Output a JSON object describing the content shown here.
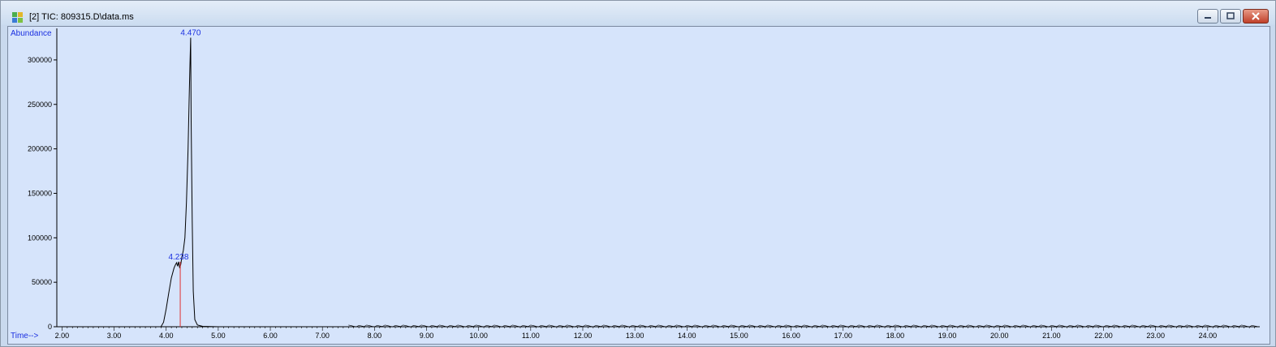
{
  "window": {
    "title": "[2] TIC: 809315.D\\data.ms",
    "icon": "chromatogram-app-icon",
    "controls": [
      "minimize",
      "restore",
      "close"
    ]
  },
  "chart_data": {
    "type": "line",
    "ylabel": "Abundance",
    "xlabel": "Time-->",
    "xlim": [
      1.9,
      25.0
    ],
    "ylim": [
      0,
      330000
    ],
    "x_ticks": [
      2.0,
      3.0,
      4.0,
      5.0,
      6.0,
      7.0,
      8.0,
      9.0,
      10.0,
      11.0,
      12.0,
      13.0,
      14.0,
      15.0,
      16.0,
      17.0,
      18.0,
      19.0,
      20.0,
      21.0,
      22.0,
      23.0,
      24.0
    ],
    "x_tick_labels": [
      "2.00",
      "3.00",
      "4.00",
      "5.00",
      "6.00",
      "7.00",
      "8.00",
      "9.00",
      "10.00",
      "11.00",
      "12.00",
      "13.00",
      "14.00",
      "15.00",
      "16.00",
      "17.00",
      "18.00",
      "19.00",
      "20.00",
      "21.00",
      "22.00",
      "23.00",
      "24.00"
    ],
    "y_ticks": [
      0,
      50000,
      100000,
      150000,
      200000,
      250000,
      300000
    ],
    "y_tick_labels": [
      "0",
      "50000",
      "100000",
      "150000",
      "200000",
      "250000",
      "300000"
    ],
    "series": [
      {
        "x": [
          1.9,
          3.9,
          3.95,
          4.0,
          4.05,
          4.1,
          4.15,
          4.18,
          4.2,
          4.22,
          4.238,
          4.26,
          4.28,
          4.3,
          4.33,
          4.36,
          4.39,
          4.42,
          4.44,
          4.455,
          4.47,
          4.48,
          4.5,
          4.52,
          4.55,
          4.6,
          4.7,
          5.0,
          25.0
        ],
        "y": [
          0,
          0,
          5000,
          20000,
          38000,
          55000,
          66000,
          70000,
          72000,
          68000,
          73000,
          66000,
          70000,
          78000,
          86000,
          100000,
          140000,
          200000,
          255000,
          290000,
          325000,
          230000,
          120000,
          40000,
          8000,
          2000,
          500,
          0,
          0
        ]
      }
    ],
    "peak_labels": [
      {
        "label": "4.238",
        "x": 4.238,
        "y": 73000
      },
      {
        "label": "4.470",
        "x": 4.47,
        "y": 325000
      }
    ],
    "marker": {
      "x": 4.27,
      "y_top": 73000,
      "color": "#e03030"
    },
    "line_color": "#000000",
    "background": "#d6e4fb",
    "label_color": "#1a2fe0"
  }
}
